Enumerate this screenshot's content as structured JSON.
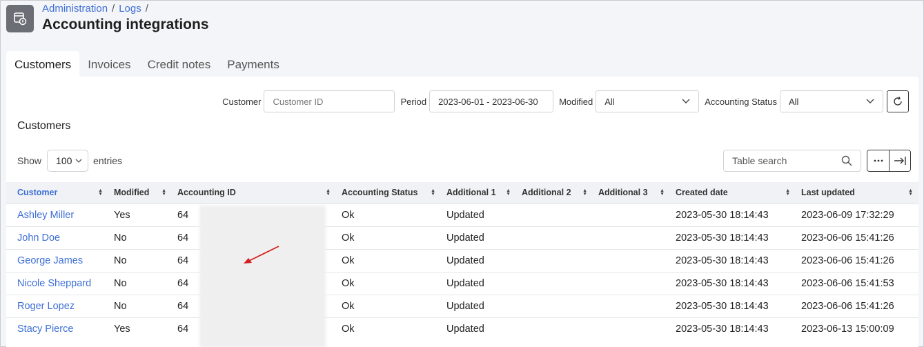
{
  "breadcrumb": {
    "items": [
      "Administration",
      "Logs"
    ],
    "sep": "/"
  },
  "page_title": "Accounting integrations",
  "tabs": [
    {
      "label": "Customers",
      "active": true
    },
    {
      "label": "Invoices",
      "active": false
    },
    {
      "label": "Credit notes",
      "active": false
    },
    {
      "label": "Payments",
      "active": false
    }
  ],
  "filters": {
    "customer": {
      "label": "Customer",
      "placeholder": "Customer ID"
    },
    "period": {
      "label": "Period",
      "value": "2023-06-01 - 2023-06-30"
    },
    "modified": {
      "label": "Modified",
      "value": "All"
    },
    "accounting_status": {
      "label": "Accounting Status",
      "value": "All"
    }
  },
  "section_title": "Customers",
  "show": {
    "prefix": "Show",
    "value": "100",
    "suffix": "entries"
  },
  "table_search": {
    "placeholder": "Table search"
  },
  "table": {
    "columns": [
      "Customer",
      "Modified",
      "Accounting ID",
      "Accounting Status",
      "Additional 1",
      "Additional 2",
      "Additional 3",
      "Created date",
      "Last updated"
    ],
    "rows": [
      [
        "Ashley Miller",
        "Yes",
        "64",
        "Ok",
        "Updated",
        "",
        "",
        "2023-05-30 18:14:43",
        "2023-06-09 17:32:29"
      ],
      [
        "John Doe",
        "No",
        "64",
        "Ok",
        "Updated",
        "",
        "",
        "2023-05-30 18:14:43",
        "2023-06-06 15:41:26"
      ],
      [
        "George James",
        "No",
        "64",
        "Ok",
        "Updated",
        "",
        "",
        "2023-05-30 18:14:43",
        "2023-06-06 15:41:26"
      ],
      [
        "Nicole Sheppard",
        "No",
        "64",
        "Ok",
        "Updated",
        "",
        "",
        "2023-05-30 18:14:43",
        "2023-06-06 15:41:53"
      ],
      [
        "Roger Lopez",
        "No",
        "64",
        "Ok",
        "Updated",
        "",
        "",
        "2023-05-30 18:14:43",
        "2023-06-06 15:41:26"
      ],
      [
        "Stacy Pierce",
        "Yes",
        "64",
        "Ok",
        "Updated",
        "",
        "",
        "2023-05-30 18:14:43",
        "2023-06-13 15:00:09"
      ]
    ]
  },
  "colors": {
    "link": "#3e6fd6",
    "annotation_arrow": "#d32020"
  }
}
